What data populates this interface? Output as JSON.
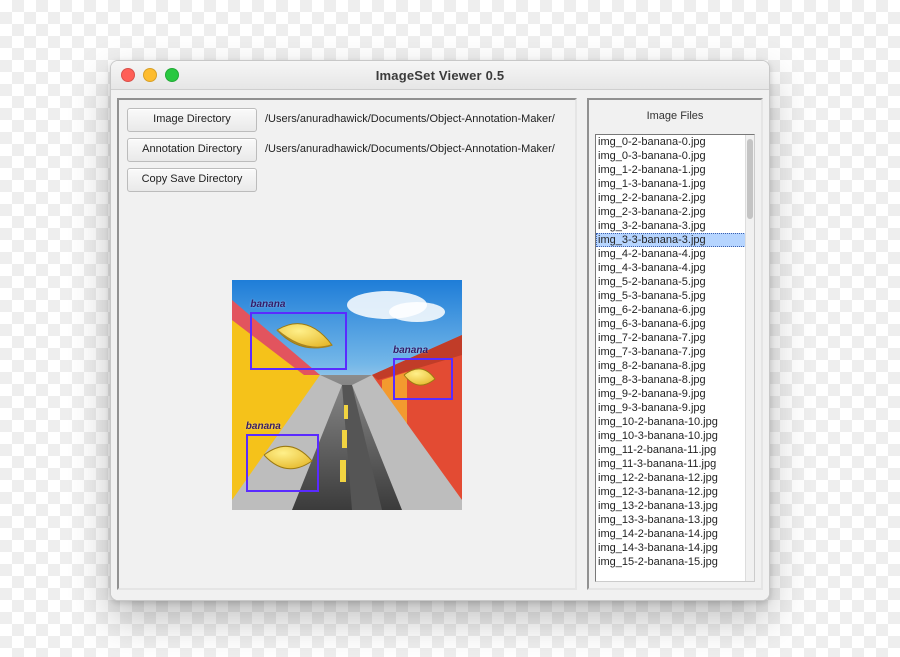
{
  "window": {
    "title": "ImageSet Viewer 0.5"
  },
  "left": {
    "buttons": {
      "image_dir": "Image Directory",
      "annotation_dir": "Annotation Directory",
      "copy_save_dir": "Copy Save Directory"
    },
    "paths": {
      "image_dir": "/Users/anuradhawick/Documents/Object-Annotation-Maker/",
      "annotation_dir": "/Users/anuradhawick/Documents/Object-Annotation-Maker/",
      "copy_save_dir": ""
    },
    "annotation_label": "banana"
  },
  "right": {
    "header": "Image Files",
    "selected_index": 7,
    "files": [
      "img_0-2-banana-0.jpg",
      "img_0-3-banana-0.jpg",
      "img_1-2-banana-1.jpg",
      "img_1-3-banana-1.jpg",
      "img_2-2-banana-2.jpg",
      "img_2-3-banana-2.jpg",
      "img_3-2-banana-3.jpg",
      "img_3-3-banana-3.jpg",
      "img_4-2-banana-4.jpg",
      "img_4-3-banana-4.jpg",
      "img_5-2-banana-5.jpg",
      "img_5-3-banana-5.jpg",
      "img_6-2-banana-6.jpg",
      "img_6-3-banana-6.jpg",
      "img_7-2-banana-7.jpg",
      "img_7-3-banana-7.jpg",
      "img_8-2-banana-8.jpg",
      "img_8-3-banana-8.jpg",
      "img_9-2-banana-9.jpg",
      "img_9-3-banana-9.jpg",
      "img_10-2-banana-10.jpg",
      "img_10-3-banana-10.jpg",
      "img_11-2-banana-11.jpg",
      "img_11-3-banana-11.jpg",
      "img_12-2-banana-12.jpg",
      "img_12-3-banana-12.jpg",
      "img_13-2-banana-13.jpg",
      "img_13-3-banana-13.jpg",
      "img_14-2-banana-14.jpg",
      "img_14-3-banana-14.jpg",
      "img_15-2-banana-15.jpg"
    ]
  }
}
